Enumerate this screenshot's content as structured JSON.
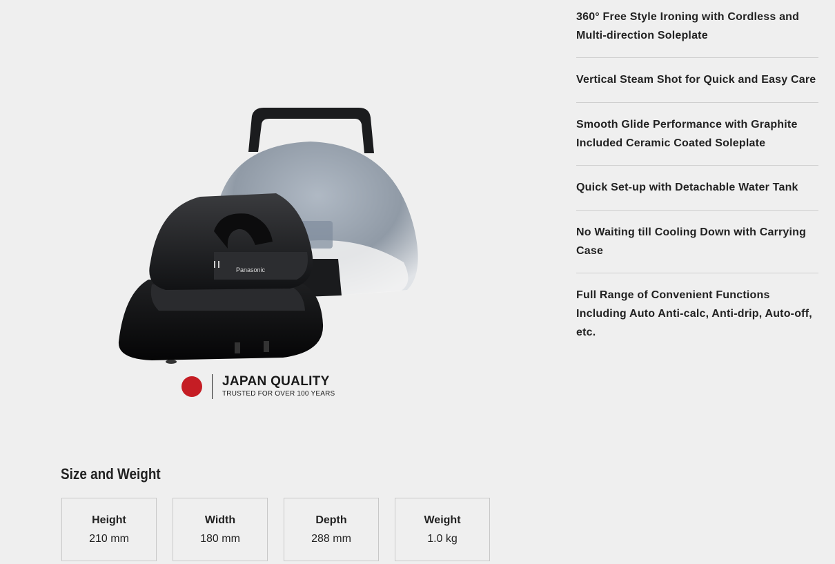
{
  "features": [
    "360° Free Style Ironing with Cordless and Multi-direction Soleplate",
    "Vertical Steam Shot for Quick and Easy Care",
    "Smooth Glide Performance with Graphite Included Ceramic Coated Soleplate",
    "Quick Set-up with Detachable Water Tank",
    "No Waiting till Cooling Down with Carrying Case",
    "Full Range of Convenient Functions Including Auto Anti-calc, Anti-drip, Auto-off, etc."
  ],
  "product": {
    "brand_mark": "Panasonic"
  },
  "badge": {
    "title": "JAPAN QUALITY",
    "subtitle": "TRUSTED FOR OVER 100 YEARS",
    "dot_color": "#c51d24"
  },
  "size_weight": {
    "title": "Size and Weight",
    "items": [
      {
        "label": "Height",
        "value": "210 mm"
      },
      {
        "label": "Width",
        "value": "180 mm"
      },
      {
        "label": "Depth",
        "value": "288 mm"
      },
      {
        "label": "Weight",
        "value": "1.0 kg"
      }
    ]
  }
}
